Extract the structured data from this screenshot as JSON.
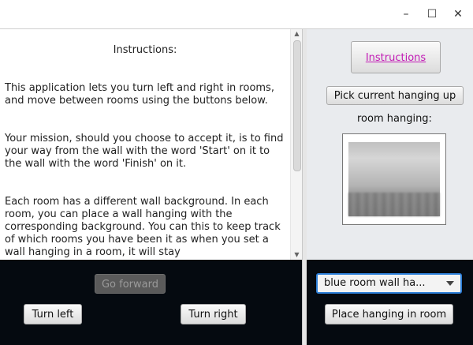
{
  "window": {
    "minimize": "–",
    "maximize": "☐",
    "close": "✕"
  },
  "instructions_text": {
    "heading": "Instructions:",
    "para1": "This application lets you turn left and right in rooms, and move between rooms using the buttons below.",
    "para2": "Your mission, should you choose to accept it, is to find your way from the wall with the word 'Start' on it to the wall with the word 'Finish' on it.",
    "para3": "Each room has a different wall background. In each room, you can place a wall hanging with the corresponding background. You can this to keep track of which rooms you have been it as when you set a wall hanging in a room, it will stay"
  },
  "scrollbar": {
    "up": "▲",
    "down": "▼"
  },
  "right_panel": {
    "instructions_button": "Instructions",
    "pick_button": "Pick current hanging up",
    "room_hanging_label": "room hanging:"
  },
  "controls": {
    "go_forward": "Go forward",
    "turn_left": "Turn left",
    "turn_right": "Turn right",
    "hanging_select": "blue room wall ha...",
    "place_button": "Place hanging in room"
  }
}
